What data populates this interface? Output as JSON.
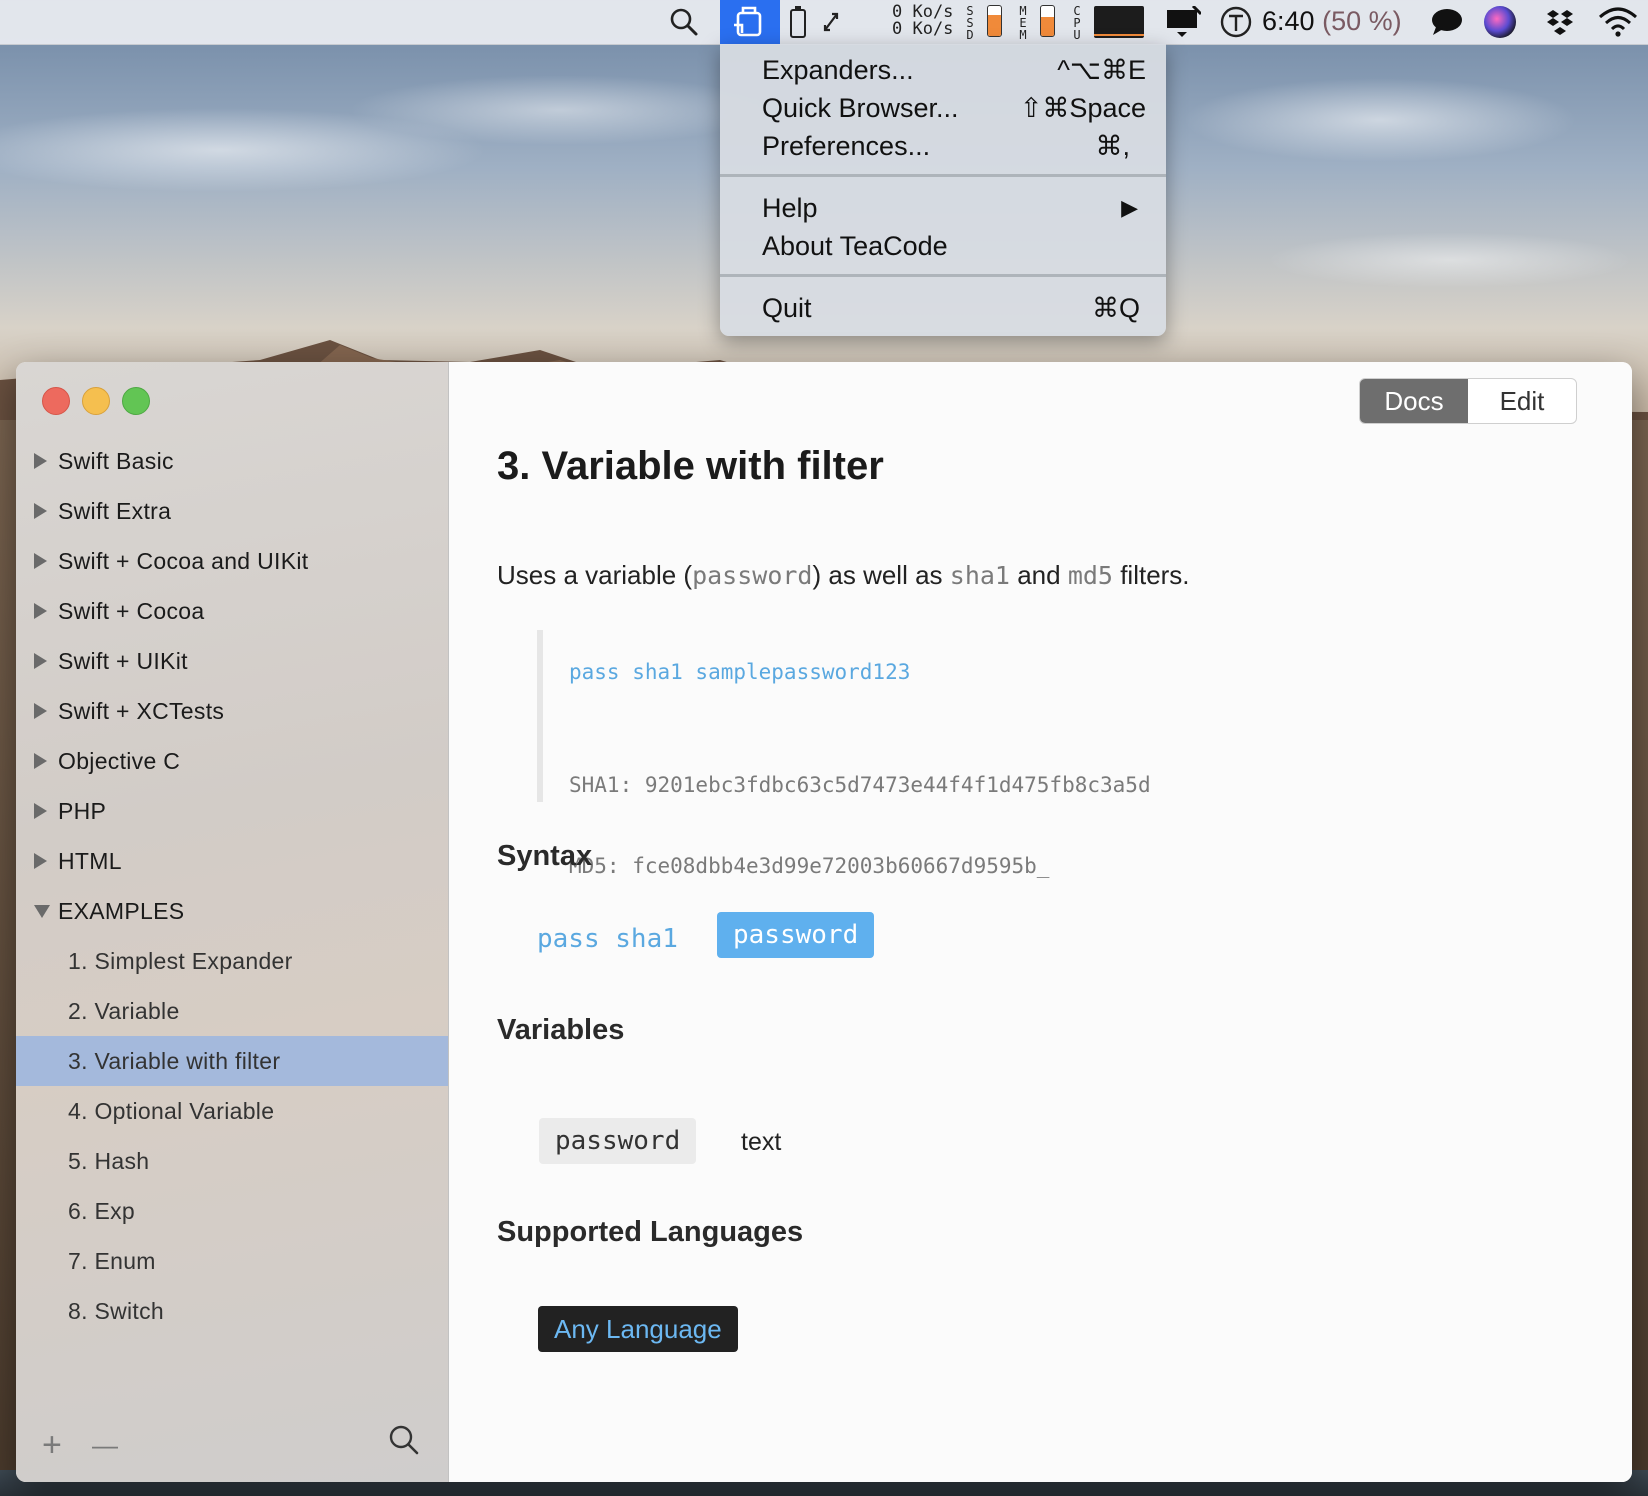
{
  "menubar": {
    "net_up": "0 Ko/s",
    "net_down": "0 Ko/s",
    "ssd_label": "SSD",
    "ssd_level": 0.7,
    "mem_label": "MEM",
    "mem_level": 0.65,
    "cpu_label": "CPU",
    "clock": "6:40",
    "battery_pct": "(50 %)",
    "icons": [
      "search-icon",
      "teacode-icon",
      "battery-icon",
      "resize-icon",
      "display-icon",
      "timing-icon",
      "message-icon",
      "siri-icon",
      "dropbox-icon",
      "wifi-icon"
    ]
  },
  "menu": {
    "items": [
      {
        "label": "Expanders...",
        "shortcut": "^⌥⌘E"
      },
      {
        "label": "Quick Browser...",
        "shortcut": "⇧⌘Space"
      },
      {
        "label": "Preferences...",
        "shortcut": "⌘,"
      },
      {
        "label": "Help",
        "shortcut": "▶"
      },
      {
        "label": "About TeaCode",
        "shortcut": ""
      },
      {
        "label": "Quit",
        "shortcut": "⌘Q"
      }
    ]
  },
  "sidebar": {
    "groups": [
      "Swift Basic",
      "Swift Extra",
      "Swift + Cocoa and UIKit",
      "Swift + Cocoa",
      "Swift + UIKit",
      "Swift + XCTests",
      "Objective C",
      "PHP",
      "HTML",
      "EXAMPLES"
    ],
    "examples": [
      "1. Simplest Expander",
      "2. Variable",
      "3. Variable with filter",
      "4. Optional Variable",
      "5. Hash",
      "6. Exp",
      "7. Enum",
      "8. Switch"
    ],
    "selected": "3. Variable with filter",
    "add_symbol": "+",
    "remove_symbol": "—"
  },
  "toolbar": {
    "docs_label": "Docs",
    "edit_label": "Edit",
    "active": "Docs"
  },
  "doc": {
    "title": "3. Variable with filter",
    "desc_parts": [
      "Uses a variable (",
      "password",
      ") as well as ",
      "sha1",
      " and ",
      "md5",
      " filters."
    ],
    "code_input": "pass sha1 samplepassword123",
    "code_output_1": "SHA1: 9201ebc3fdbc63c5d7473e44f4f1d475fb8c3a5d",
    "code_output_2": "MD5: fce08dbb4e3d99e72003b60667d9595b_",
    "syntax_heading": "Syntax",
    "syntax_plain": "pass sha1",
    "syntax_var": "password",
    "variables_heading": "Variables",
    "var_name": "password",
    "var_type": "text",
    "languages_heading": "Supported Languages",
    "language": "Any Language"
  },
  "colors": {
    "accent": "#2a6ff0",
    "selection": "#a4b9dc",
    "code_blue": "#5aa8e0",
    "close": "#ed6a5e",
    "minimize": "#f5bf4f",
    "zoom": "#62c554"
  }
}
